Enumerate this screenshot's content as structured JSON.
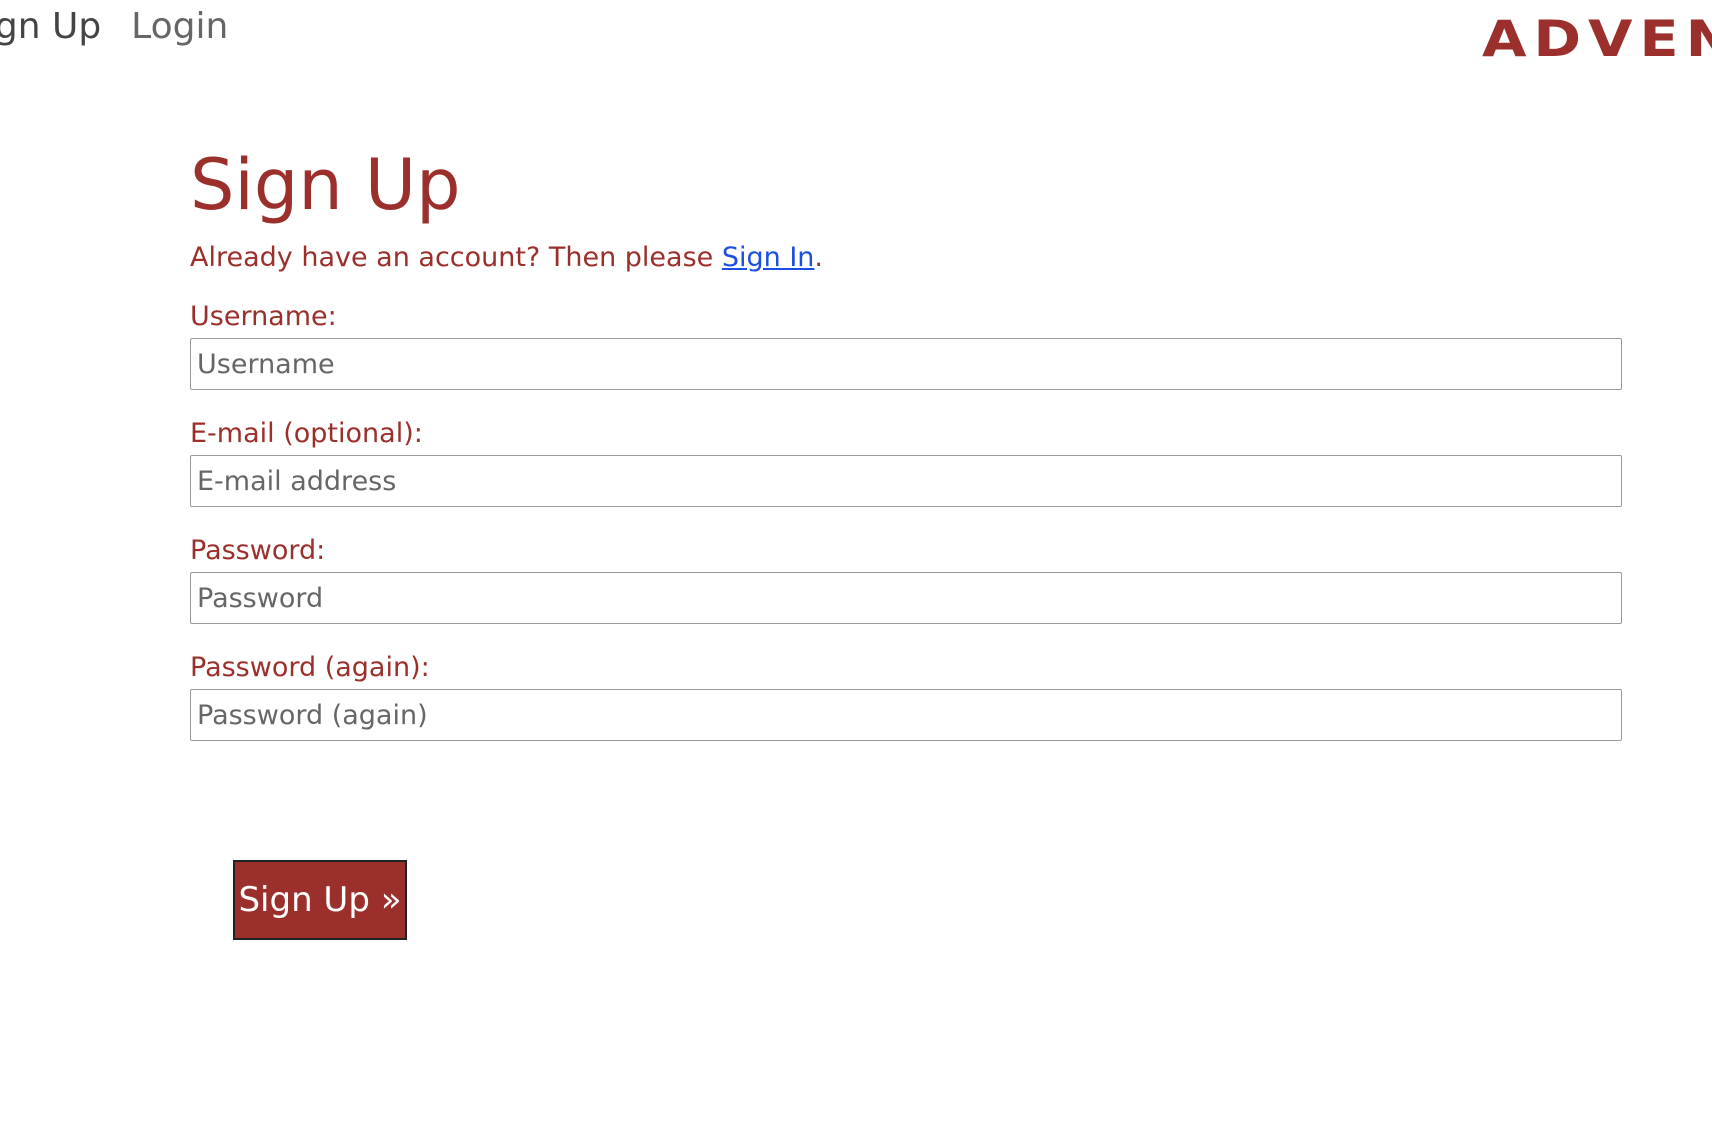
{
  "nav": {
    "signup": "Sign Up",
    "login": "Login"
  },
  "logo": "ADVENT",
  "page": {
    "title": "Sign Up",
    "sub_prefix": "Already have an account? Then please ",
    "signin_link": "Sign In",
    "sub_suffix": "."
  },
  "fields": [
    {
      "label": "Username:",
      "placeholder": "Username"
    },
    {
      "label": "E-mail (optional):",
      "placeholder": "E-mail address"
    },
    {
      "label": "Password:",
      "placeholder": "Password"
    },
    {
      "label": "Password (again):",
      "placeholder": "Password (again)"
    }
  ],
  "submit": "Sign Up »"
}
